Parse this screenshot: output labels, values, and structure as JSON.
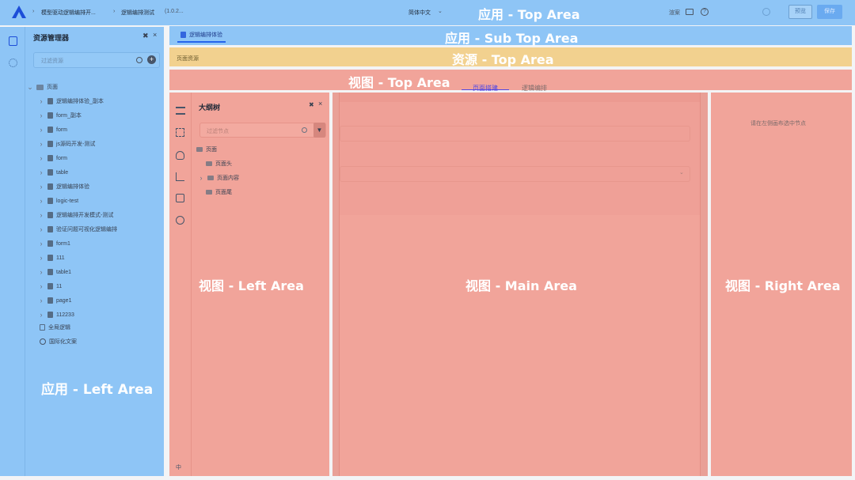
{
  "topbar": {
    "breadcrumb1": "模型驱动逻辑编排开...",
    "breadcrumb2": "逻辑编排测试",
    "version": "(1.0.2...",
    "language": "简体中文",
    "right_label": "渲案",
    "preview_button": "预览",
    "publish_button": "保存"
  },
  "tabs": {
    "active": "逻辑编排体验"
  },
  "resource_bar": {
    "label": "页面资源"
  },
  "view_tabs": [
    "页面搭建",
    "逻辑编排"
  ],
  "explorer": {
    "title": "资源管理器",
    "search_placeholder": "过滤资源",
    "root": "页面",
    "items": [
      "逻辑编排体验_副本",
      "form_副本",
      "form",
      "js源码开发-测试",
      "form",
      "table",
      "逻辑编排体验",
      "logic-test",
      "逻辑编排开发模式-测试",
      "验证问题可视化逻辑编排",
      "form1",
      "111",
      "table1",
      "11",
      "page1",
      "112233"
    ],
    "extras": [
      "全局逻辑",
      "国际化文案"
    ]
  },
  "outline": {
    "title": "大纲树",
    "search_placeholder": "过滤节点",
    "root": "页面",
    "children": [
      "页面头",
      "页面内容",
      "页面尾"
    ]
  },
  "right_panel": {
    "hint": "请在左侧画布选中节点"
  },
  "bottom_glyph": "中",
  "overlays": {
    "app_top": "应用 - Top Area",
    "app_sub_top": "应用 - Sub Top Area",
    "res_top": "资源 - Top Area",
    "view_top": "视图 - Top Area",
    "view_left": "视图 - Left Area",
    "view_main": "视图 - Main Area",
    "view_right": "视图 - Right Area",
    "app_left": "应用 - Left Area"
  },
  "colors": {
    "blue_overlay": "#8ec5f6",
    "orange_overlay": "#f2d18f",
    "red_overlay": "#f1a49a",
    "accent": "#2563eb"
  }
}
